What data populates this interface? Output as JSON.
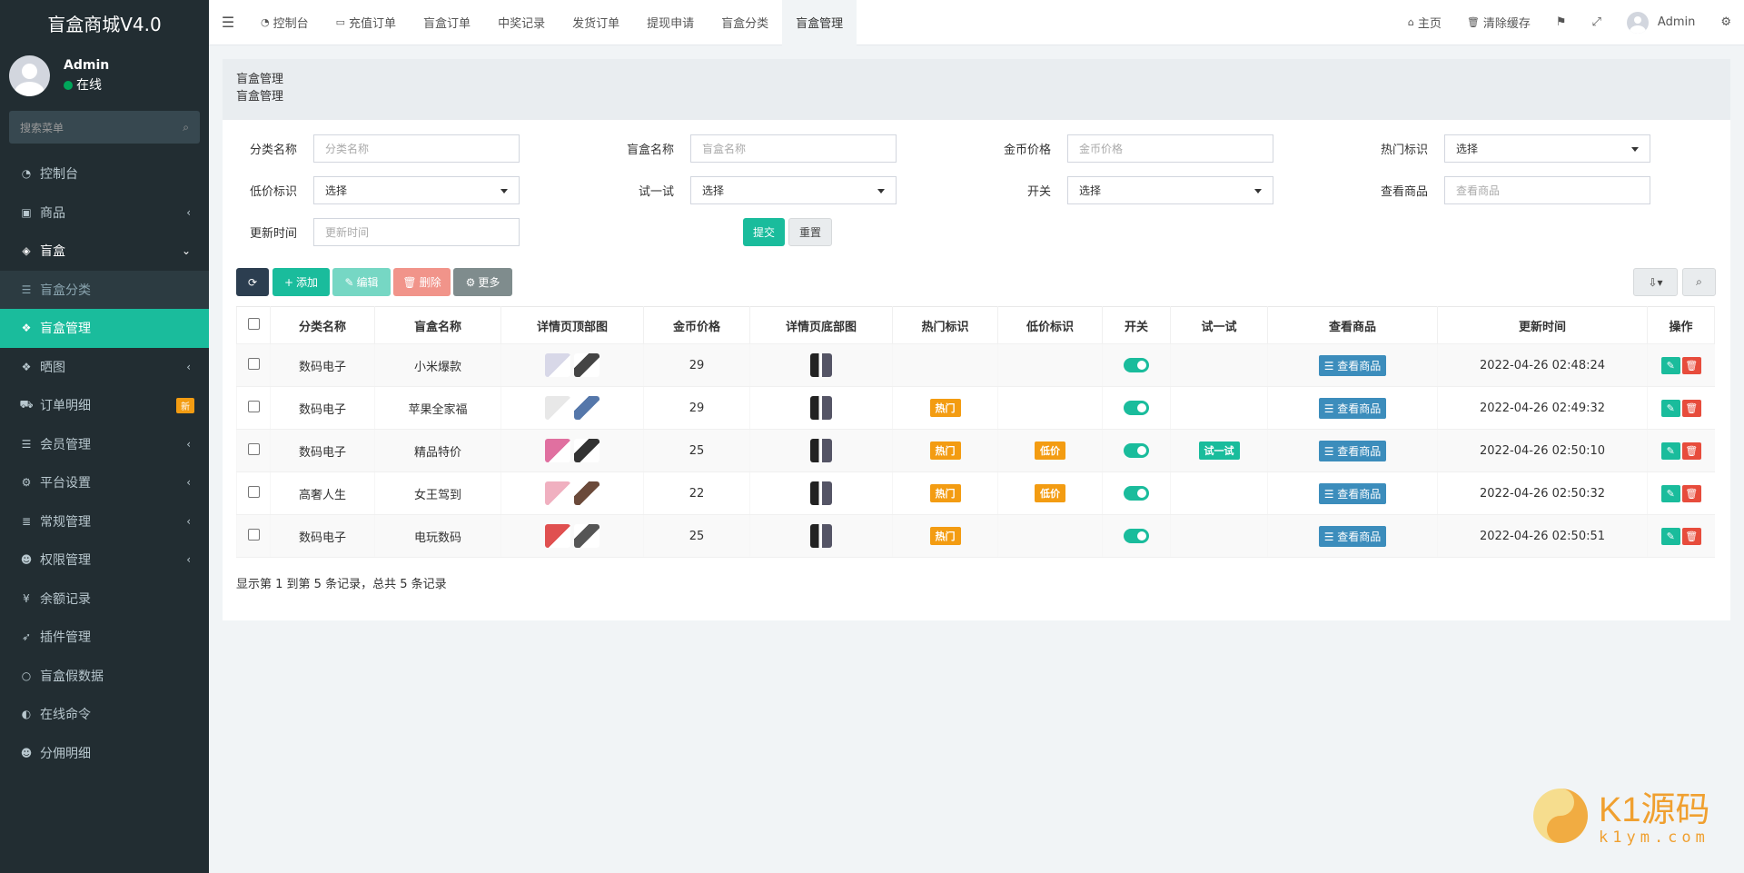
{
  "app": {
    "title": "盲盒商城V4.0"
  },
  "user": {
    "name": "Admin",
    "status": "在线"
  },
  "sidebar": {
    "search_placeholder": "搜索菜单",
    "items": [
      {
        "label": "控制台",
        "icon": "dashboard-icon"
      },
      {
        "label": "商品",
        "icon": "shopping-bag-icon",
        "arrow": "‹"
      },
      {
        "label": "盲盒",
        "icon": "cube-icon",
        "arrow": "⌄"
      },
      {
        "label": "盲盒分类",
        "icon": "list-icon"
      },
      {
        "label": "盲盒管理",
        "icon": "cubes-icon"
      },
      {
        "label": "晒图",
        "icon": "dropbox-icon",
        "arrow": "‹"
      },
      {
        "label": "订单明细",
        "icon": "cart-icon",
        "badge": "新"
      },
      {
        "label": "会员管理",
        "icon": "list-icon",
        "arrow": "‹"
      },
      {
        "label": "平台设置",
        "icon": "gear-icon",
        "arrow": "‹"
      },
      {
        "label": "常规管理",
        "icon": "database-icon",
        "arrow": "‹"
      },
      {
        "label": "权限管理",
        "icon": "users-icon",
        "arrow": "‹"
      },
      {
        "label": "余额记录",
        "icon": "yen-icon"
      },
      {
        "label": "插件管理",
        "icon": "rocket-icon"
      },
      {
        "label": "盲盒假数据",
        "icon": "circle-icon"
      },
      {
        "label": "在线命令",
        "icon": "adjust-icon"
      },
      {
        "label": "分佣明细",
        "icon": "users-icon"
      }
    ]
  },
  "topnav": [
    {
      "label": "控制台",
      "icon": "dashboard-icon"
    },
    {
      "label": "充值订单",
      "icon": "battery-icon"
    },
    {
      "label": "盲盒订单"
    },
    {
      "label": "中奖记录"
    },
    {
      "label": "发货订单"
    },
    {
      "label": "提现申请"
    },
    {
      "label": "盲盒分类"
    },
    {
      "label": "盲盒管理"
    }
  ],
  "topright": {
    "home": "主页",
    "clear_cache": "清除缓存",
    "user": "Admin"
  },
  "page": {
    "title": "盲盒管理",
    "subtitle": "盲盒管理"
  },
  "filters": {
    "category": {
      "label": "分类名称",
      "placeholder": "分类名称"
    },
    "box_name": {
      "label": "盲盒名称",
      "placeholder": "盲盒名称"
    },
    "coin_price": {
      "label": "金币价格",
      "placeholder": "金币价格"
    },
    "hot": {
      "label": "热门标识",
      "value": "选择"
    },
    "low": {
      "label": "低价标识",
      "value": "选择"
    },
    "try": {
      "label": "试一试",
      "value": "选择"
    },
    "switch": {
      "label": "开关",
      "value": "选择"
    },
    "goods": {
      "label": "查看商品",
      "placeholder": "查看商品"
    },
    "updated": {
      "label": "更新时间",
      "placeholder": "更新时间"
    },
    "submit": "提交",
    "reset": "重置"
  },
  "toolbar": {
    "add": "添加",
    "edit": "编辑",
    "delete": "删除",
    "more": "更多"
  },
  "table": {
    "headers": [
      "分类名称",
      "盲盒名称",
      "详情页顶部图",
      "金币价格",
      "详情页底部图",
      "热门标识",
      "低价标识",
      "开关",
      "试一试",
      "查看商品",
      "更新时间",
      "操作"
    ],
    "view_label": "查看商品",
    "rows": [
      {
        "category": "数码电子",
        "name": "小米爆款",
        "price": "29",
        "hot": "",
        "low": "",
        "try": "",
        "updated": "2022-04-26 02:48:24"
      },
      {
        "category": "数码电子",
        "name": "苹果全家福",
        "price": "29",
        "hot": "热门",
        "low": "",
        "try": "",
        "updated": "2022-04-26 02:49:32"
      },
      {
        "category": "数码电子",
        "name": "精品特价",
        "price": "25",
        "hot": "热门",
        "low": "低价",
        "try": "试一试",
        "updated": "2022-04-26 02:50:10"
      },
      {
        "category": "高奢人生",
        "name": "女王驾到",
        "price": "22",
        "hot": "热门",
        "low": "低价",
        "try": "",
        "updated": "2022-04-26 02:50:32"
      },
      {
        "category": "数码电子",
        "name": "电玩数码",
        "price": "25",
        "hot": "热门",
        "low": "",
        "try": "",
        "updated": "2022-04-26 02:50:51"
      }
    ]
  },
  "summary": "显示第 1 到第 5 条记录，总共 5 条记录",
  "watermark": {
    "brand": "K1源码",
    "url": "k1ym.com"
  },
  "colors": {
    "accent": "#1abc9c",
    "sidebar": "#222d32",
    "hot": "#f39c12",
    "view": "#3c8dbc",
    "delete": "#e74c3c"
  }
}
